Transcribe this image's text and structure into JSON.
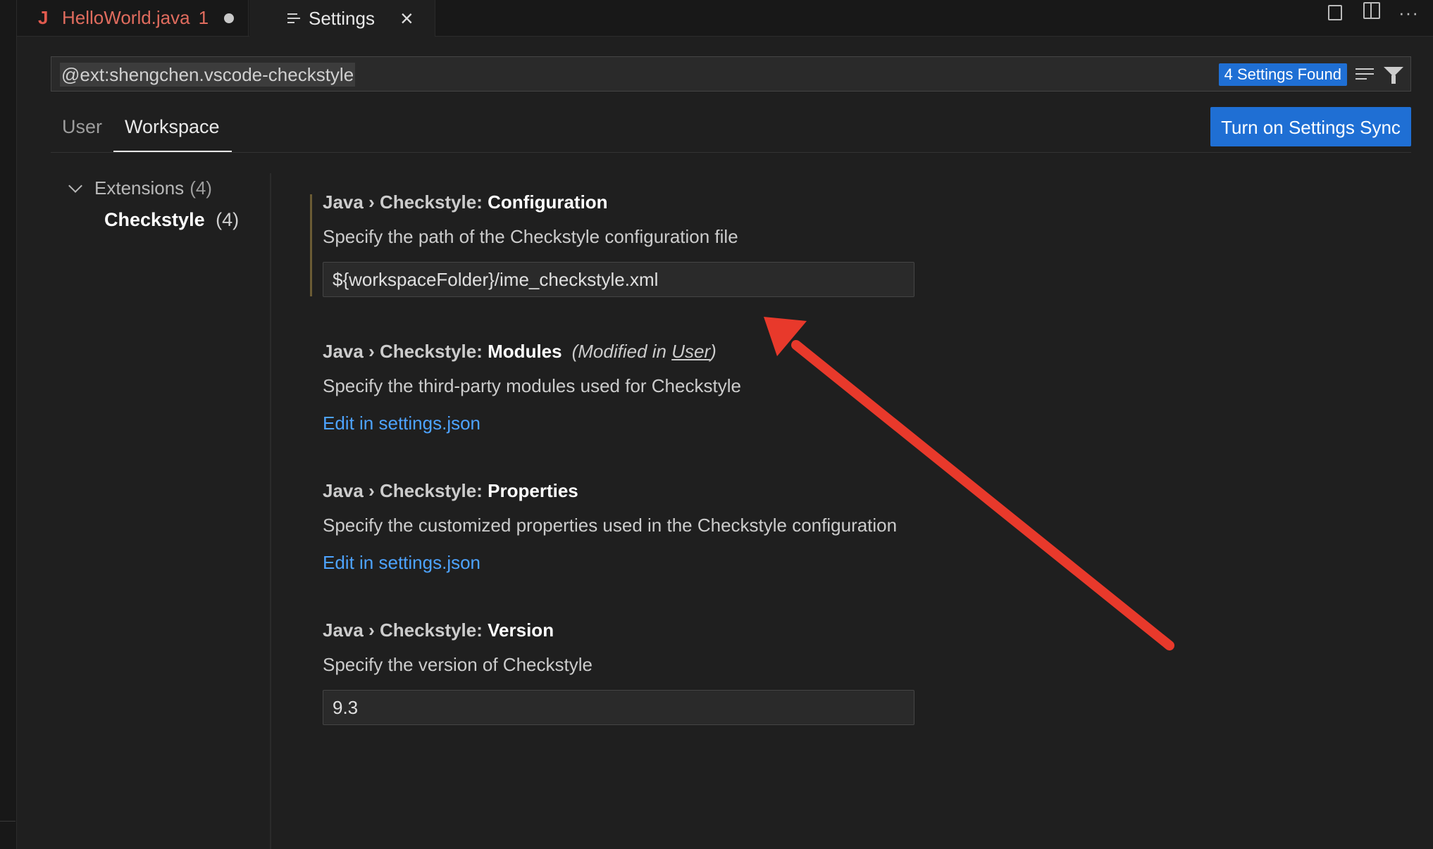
{
  "tabs": [
    {
      "icon": "java-icon",
      "label": "HelloWorld.java",
      "problems": "1",
      "modified": true
    },
    {
      "icon": "settings-icon",
      "label": "Settings",
      "active": true
    }
  ],
  "search": {
    "query": "@ext:shengchen.vscode-checkstyle",
    "results_badge": "4 Settings Found"
  },
  "scope_tabs": {
    "user": "User",
    "workspace": "Workspace",
    "active": "Workspace"
  },
  "sync_button": "Turn on Settings Sync",
  "toc": {
    "extensions_label": "Extensions",
    "extensions_count": "(4)",
    "checkstyle_label": "Checkstyle",
    "checkstyle_count": "(4)"
  },
  "settings": [
    {
      "category": "Java › Checkstyle: ",
      "name": "Configuration",
      "description": "Specify the path of the Checkstyle configuration file",
      "value": "${workspaceFolder}/ime_checkstyle.xml"
    },
    {
      "category": "Java › Checkstyle: ",
      "name": "Modules",
      "modified_prefix": "(Modified in ",
      "modified_scope": "User",
      "modified_suffix": ")",
      "description": "Specify the third-party modules used for Checkstyle",
      "link": "Edit in settings.json"
    },
    {
      "category": "Java › Checkstyle: ",
      "name": "Properties",
      "description": "Specify the customized properties used in the Checkstyle configuration",
      "link": "Edit in settings.json"
    },
    {
      "category": "Java › Checkstyle: ",
      "name": "Version",
      "description": "Specify the version of Checkstyle",
      "value": "9.3"
    }
  ],
  "colors": {
    "accent": "#1f6fd4",
    "link": "#4da3ff",
    "annotation_arrow": "#e8392b",
    "error_tab": "#e06c5e"
  }
}
